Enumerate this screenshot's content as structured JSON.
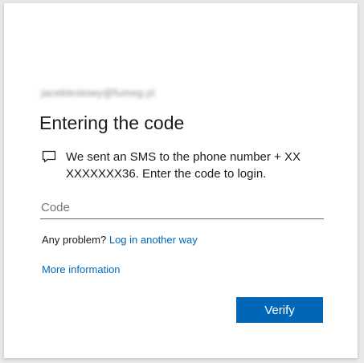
{
  "account": {
    "email": "jacektestowy@fumeg.pl"
  },
  "title": "Entering the code",
  "message": {
    "icon": "chat-bubble-icon",
    "line1": "We sent an SMS to the phone number + XX",
    "line2": "XXXXXXX36. Enter the code to login."
  },
  "code_field": {
    "placeholder": "Code",
    "value": ""
  },
  "problem": {
    "prefix": "Any problem?",
    "link_label": "Log in another way"
  },
  "more_info_label": "More information",
  "verify_label": "Verify",
  "colors": {
    "accent": "#0067b8",
    "background": "#e9e9e9",
    "card": "#ffffff"
  }
}
